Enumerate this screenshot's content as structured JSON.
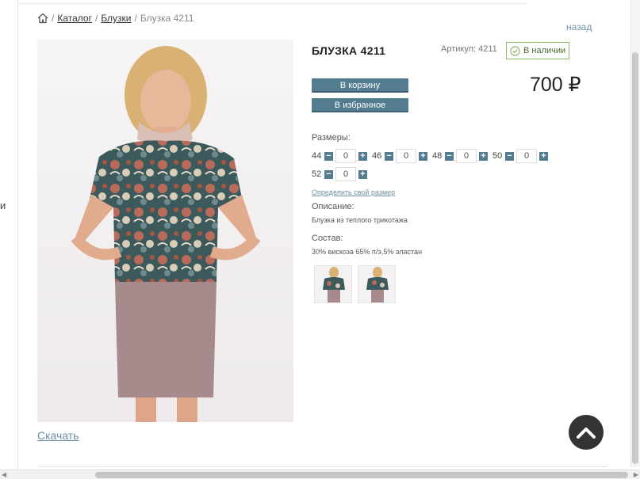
{
  "breadcrumb": {
    "home_icon": "home-icon",
    "separator": "/",
    "catalog": "Каталог",
    "category": "Блузки",
    "current": "Блузка 4211"
  },
  "left_cut_text": "и",
  "back_label": "назад",
  "product": {
    "title": "БЛУЗКА 4211",
    "sku": "Артикул: 4211",
    "stock": "В наличии",
    "price": "700 ₽",
    "add_to_cart": "В корзину",
    "add_to_favorites": "В избранное",
    "sizes_label": "Размеры:",
    "sizes": [
      {
        "size": "44",
        "qty": "0"
      },
      {
        "size": "46",
        "qty": "0"
      },
      {
        "size": "48",
        "qty": "0"
      },
      {
        "size": "50",
        "qty": "0"
      },
      {
        "size": "52",
        "qty": "0"
      }
    ],
    "size_link": "Определить свой размер",
    "description_label": "Описание:",
    "description": "Блузка из теплого трикотажа",
    "composition_label": "Состав:",
    "composition": "30% вискоза 65% п/э,5% эластан",
    "download": "Скачать"
  },
  "colors": {
    "accent": "#537c8f",
    "stock_border": "#8fb86c",
    "link": "#6d8fa8"
  }
}
